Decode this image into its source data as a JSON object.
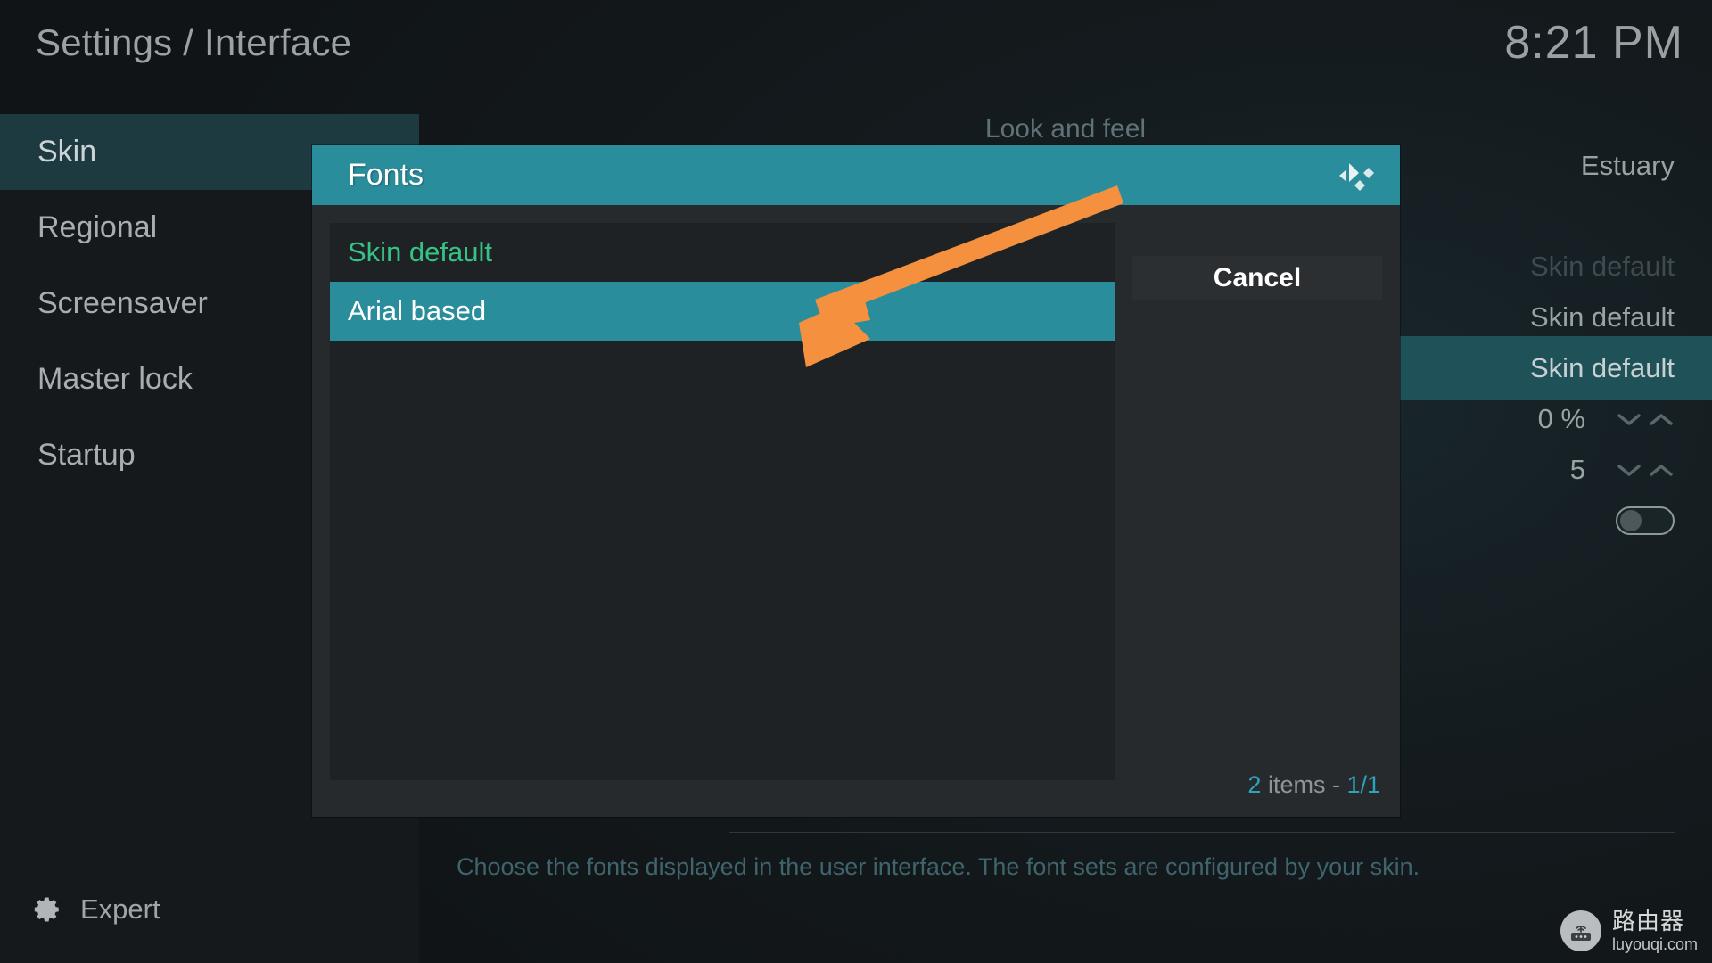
{
  "header": {
    "title": "Settings / Interface",
    "clock": "8:21 PM"
  },
  "sidebar": {
    "items": [
      {
        "label": "Skin",
        "selected": true
      },
      {
        "label": "Regional",
        "selected": false
      },
      {
        "label": "Screensaver",
        "selected": false
      },
      {
        "label": "Master lock",
        "selected": false
      },
      {
        "label": "Startup",
        "selected": false
      }
    ],
    "level_button": {
      "label": "Expert",
      "icon": "gear-icon"
    }
  },
  "settings_panel": {
    "section_title": "Look and feel",
    "rows": [
      {
        "value": "Estuary",
        "state": "normal",
        "control": "none"
      },
      {
        "value": "Skin default",
        "state": "dim",
        "control": "none"
      },
      {
        "value": "Skin default",
        "state": "normal",
        "control": "none"
      },
      {
        "value": "Skin default",
        "state": "bright",
        "control": "none",
        "selected": true
      },
      {
        "value": "0 %",
        "state": "normal",
        "control": "spinner"
      },
      {
        "value": "5",
        "state": "normal",
        "control": "spinner"
      },
      {
        "value": "",
        "state": "normal",
        "control": "toggle",
        "toggle_on": false
      }
    ],
    "description": "Choose the fonts displayed in the user interface. The font sets are configured by your skin."
  },
  "dialog": {
    "title": "Fonts",
    "logo_icon": "kodi-logo-icon",
    "list": [
      {
        "label": "Skin default",
        "state": "current"
      },
      {
        "label": "Arial based",
        "state": "focused"
      }
    ],
    "cancel_label": "Cancel",
    "item_count": {
      "count": "2",
      "middle": " items - ",
      "page": "1/1"
    }
  },
  "annotation": {
    "arrow_color": "#f5903f"
  },
  "watermark": {
    "cn": "路由器",
    "url": "luyouqi.com",
    "icon": "router-icon"
  },
  "colors": {
    "accent_teal": "#2a8d9c",
    "selected_row": "#1f5159",
    "sidebar_selected": "#1d3a40",
    "current_green": "#36c285",
    "description_teal": "#3f646c",
    "count_teal": "#2ea3bb"
  }
}
